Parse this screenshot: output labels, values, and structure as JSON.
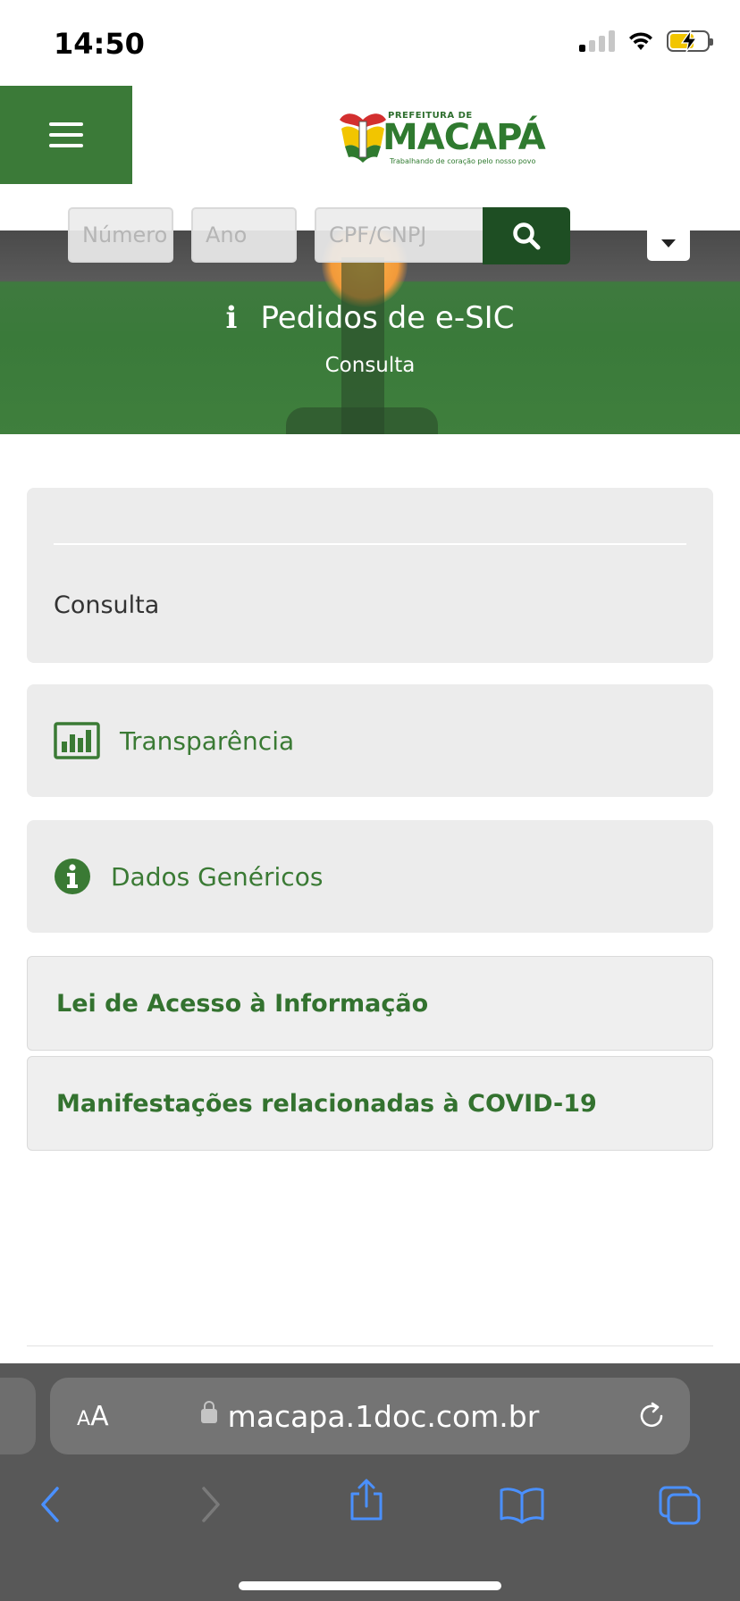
{
  "status": {
    "time": "14:50",
    "battery_color": "#f2c500"
  },
  "header": {
    "menu_icon": "hamburger-icon",
    "logo": {
      "small": "PREFEITURA DE",
      "big": "MACAPÁ",
      "tagline": "Trabalhando de coração pelo nosso povo"
    },
    "brand_color": "#3b7a38"
  },
  "search": {
    "numero_placeholder": "Número",
    "ano_placeholder": "Ano",
    "cpf_placeholder": "CPF/CNPJ",
    "button_icon": "search-icon"
  },
  "hero": {
    "icon": "info-icon",
    "title": "Pedidos de e-SIC",
    "subtitle": "Consulta"
  },
  "cards": {
    "consulta": "Consulta",
    "transparencia": {
      "label": "Transparência",
      "icon": "bar-chart-icon"
    },
    "dados": {
      "label": "Dados Genéricos",
      "icon": "info-circle-icon"
    },
    "lei": "Lei de Acesso à Informação",
    "covid": "Manifestações relacionadas à COVID-19"
  },
  "browser": {
    "text_size_label_small": "A",
    "text_size_label_big": "A",
    "url": "macapa.1doc.com.br"
  }
}
